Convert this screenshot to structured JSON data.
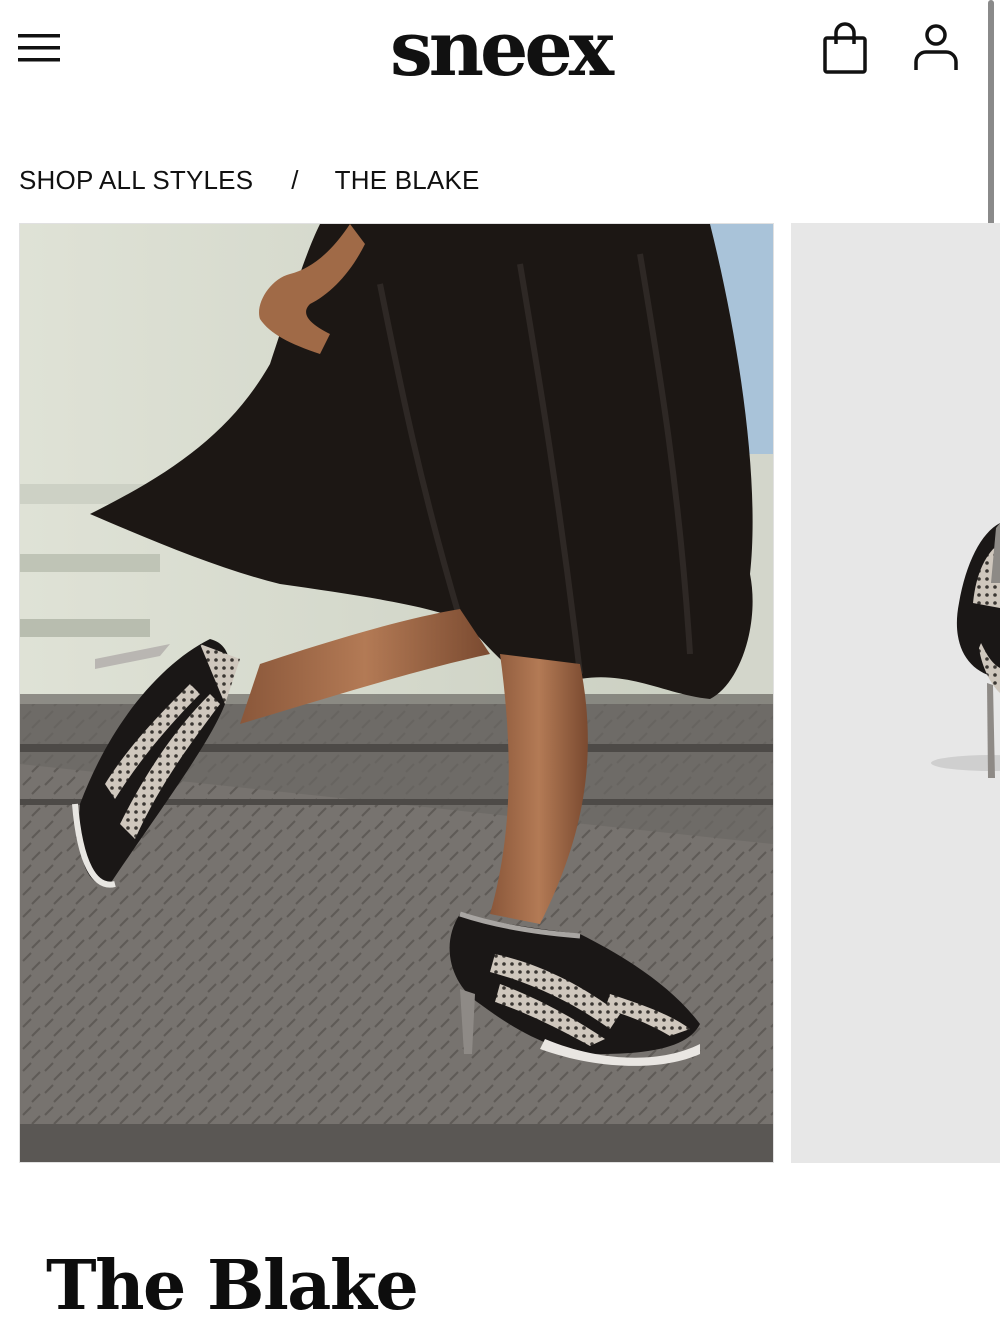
{
  "header": {
    "brand": "sneex",
    "menu_icon": "hamburger-menu-icon",
    "bag_icon": "shopping-bag-icon",
    "account_icon": "user-account-icon"
  },
  "breadcrumb": {
    "items": [
      {
        "label": "SHOP ALL STYLES"
      },
      {
        "label": "THE BLAKE"
      }
    ],
    "separator": "/"
  },
  "gallery": {
    "images": [
      {
        "description_icon": "product-lifestyle-photo"
      },
      {
        "description_icon": "product-studio-photo"
      }
    ]
  },
  "product": {
    "title": "The Blake"
  },
  "colors": {
    "text": "#111111",
    "background": "#ffffff",
    "next_slide_bg": "#e7e7e7"
  }
}
